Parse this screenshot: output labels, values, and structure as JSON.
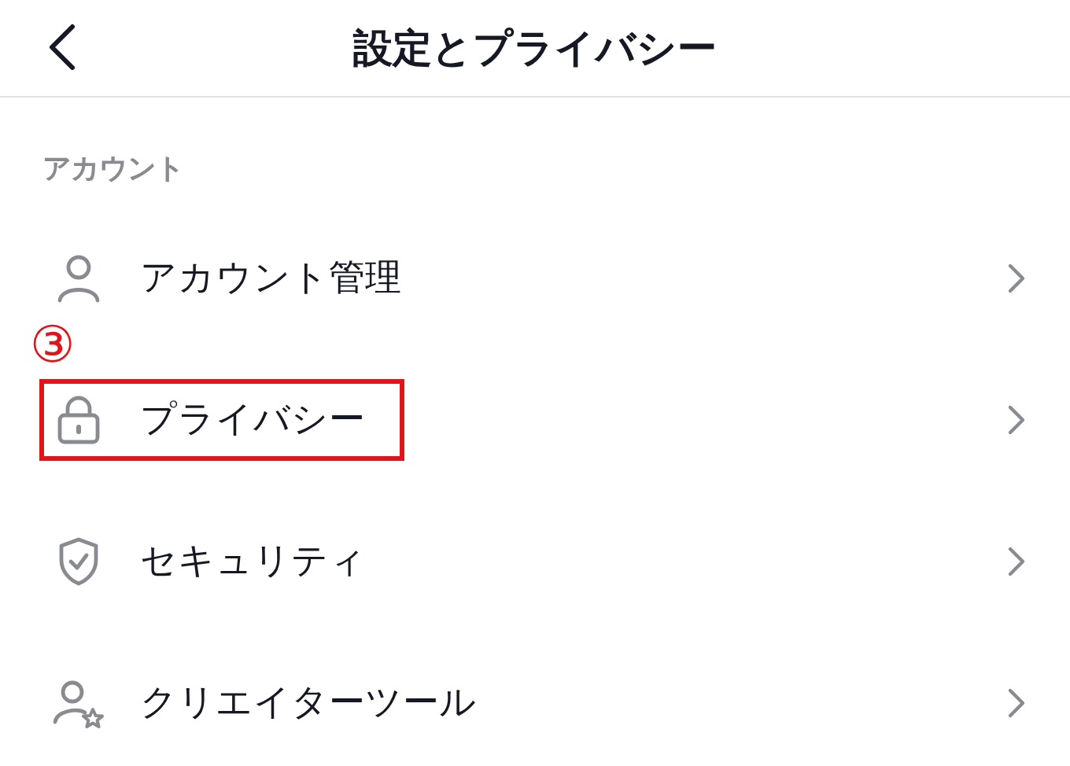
{
  "header": {
    "title": "設定とプライバシー"
  },
  "section": {
    "label": "アカウント",
    "items": [
      {
        "label": "アカウント管理",
        "highlighted": false
      },
      {
        "label": "プライバシー",
        "highlighted": true,
        "annotation": "③"
      },
      {
        "label": "セキュリティ",
        "highlighted": false
      },
      {
        "label": "クリエイターツール",
        "highlighted": false
      }
    ]
  }
}
